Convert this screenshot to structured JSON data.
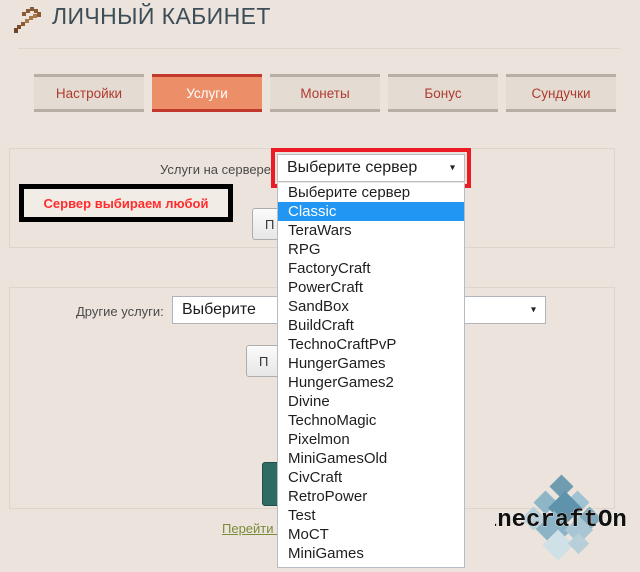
{
  "header": {
    "title": "ЛИЧНЫЙ КАБИНЕТ",
    "icon": "pickaxe-icon"
  },
  "tabs": [
    {
      "label": "Настройки",
      "active": false
    },
    {
      "label": "Услуги",
      "active": true
    },
    {
      "label": "Монеты",
      "active": false
    },
    {
      "label": "Бонус",
      "active": false
    },
    {
      "label": "Сундучки",
      "active": false
    }
  ],
  "server_section": {
    "label": "Услуги на сервере:",
    "select_value": "Выберите сервер",
    "arrow": "▾",
    "submit_label": "П",
    "highlight_color": "#ed1c24"
  },
  "annotation": {
    "text": "Сервер выбираем любой"
  },
  "dropdown": {
    "selected": "Classic",
    "options": [
      "Выберите сервер",
      "Classic",
      "TeraWars",
      "RPG",
      "FactoryCraft",
      "PowerCraft",
      "SandBox",
      "BuildCraft",
      "TechnoCraftPvP",
      "HungerGames",
      "HungerGames2",
      "Divine",
      "TechnoMagic",
      "Pixelmon",
      "MiniGamesOld",
      "CivCraft",
      "RetroPower",
      "Test",
      "MoCT",
      "MiniGames"
    ]
  },
  "other_section": {
    "label": "Другие услуги:",
    "select_value": "Выберите",
    "arrow": "▾",
    "submit_label": "П"
  },
  "footer": {
    "link_text": "Перейти к"
  },
  "logo": {
    "text": "MinecraftOnly"
  }
}
